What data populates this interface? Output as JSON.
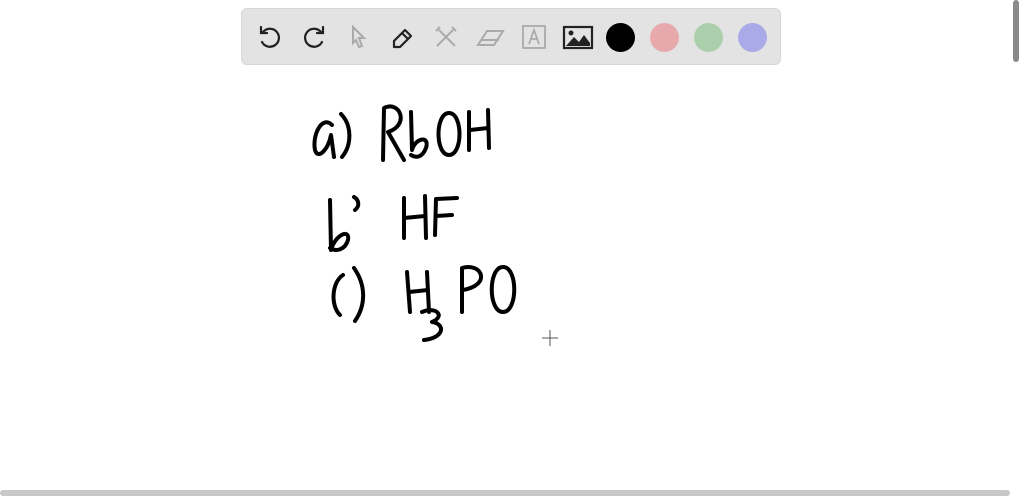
{
  "toolbar": {
    "tools": [
      {
        "name": "undo",
        "icon": "undo-icon",
        "enabled": true
      },
      {
        "name": "redo",
        "icon": "redo-icon",
        "enabled": true
      },
      {
        "name": "select",
        "icon": "cursor-icon",
        "enabled": false
      },
      {
        "name": "pen",
        "icon": "pencil-icon",
        "enabled": true
      },
      {
        "name": "tools",
        "icon": "tools-icon",
        "enabled": false
      },
      {
        "name": "eraser",
        "icon": "eraser-icon",
        "enabled": false
      },
      {
        "name": "text",
        "icon": "text-icon",
        "enabled": false
      },
      {
        "name": "image",
        "icon": "image-icon",
        "enabled": true
      }
    ],
    "colors": [
      "#000000",
      "#e8a9ad",
      "#abcfab",
      "#aaaae8"
    ],
    "selected_color": "#000000"
  },
  "canvas": {
    "handwriting": [
      "a) RbOH",
      "b) HF",
      "c) H3PO"
    ]
  }
}
